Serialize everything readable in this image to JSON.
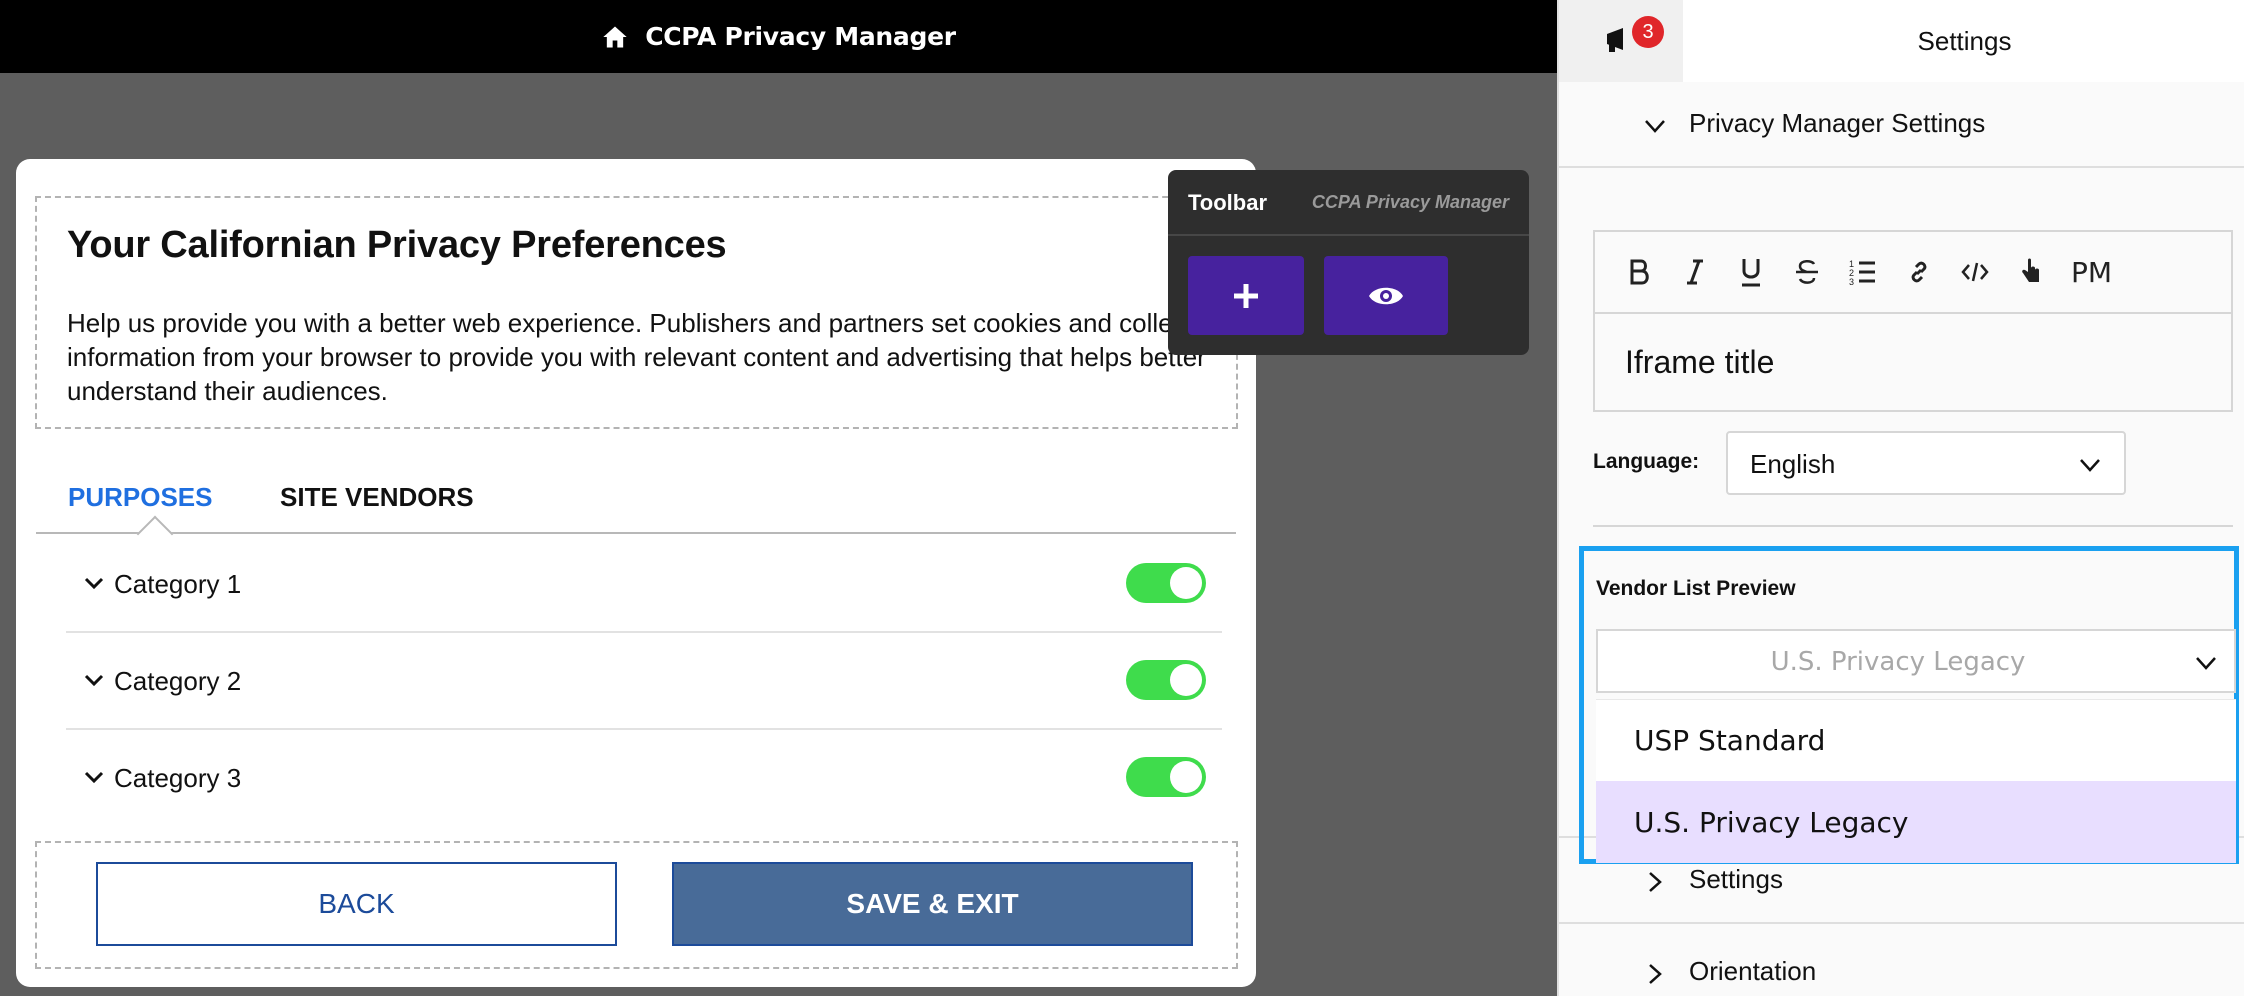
{
  "topbar": {
    "title": "CCPA Privacy Manager"
  },
  "modal": {
    "heading": "Your Californian Privacy Preferences",
    "description": "Help us provide you with a better web experience. Publishers and partners set cookies and collect information from your browser to provide you with relevant content and advertising that helps better understand their audiences.",
    "tabs": [
      {
        "label": "PURPOSES",
        "active": true
      },
      {
        "label": "SITE VENDORS",
        "active": false
      }
    ],
    "categories": [
      {
        "label": "Category 1",
        "enabled": true
      },
      {
        "label": "Category 2",
        "enabled": true
      },
      {
        "label": "Category 3",
        "enabled": true
      }
    ],
    "buttons": {
      "back": "BACK",
      "save": "SAVE & EXIT"
    }
  },
  "toolbar": {
    "label": "Toolbar",
    "subtitle": "CCPA Privacy Manager"
  },
  "panel": {
    "notification_count": "3",
    "title": "Settings",
    "privacy_section": "Privacy Manager Settings",
    "editor": {
      "content": "Iframe title",
      "pm_label": "PM"
    },
    "language": {
      "label": "Language:",
      "value": "English"
    },
    "vendor_list": {
      "label": "Vendor List Preview",
      "placeholder": "U.S. Privacy Legacy",
      "options": [
        "USP Standard",
        "U.S. Privacy Legacy"
      ],
      "highlighted_option": "U.S. Privacy Legacy"
    },
    "sections": [
      {
        "label": "Settings"
      },
      {
        "label": "Orientation"
      }
    ]
  },
  "colors": {
    "accent_blue": "#1f6fe0",
    "toggle_green": "#3fdc4c",
    "toolbar_purple": "#47229e",
    "save_blue": "#486b98",
    "highlight_frame": "#1aa0f0",
    "option_highlight": "#e8deff",
    "badge_red": "#e0262a"
  }
}
